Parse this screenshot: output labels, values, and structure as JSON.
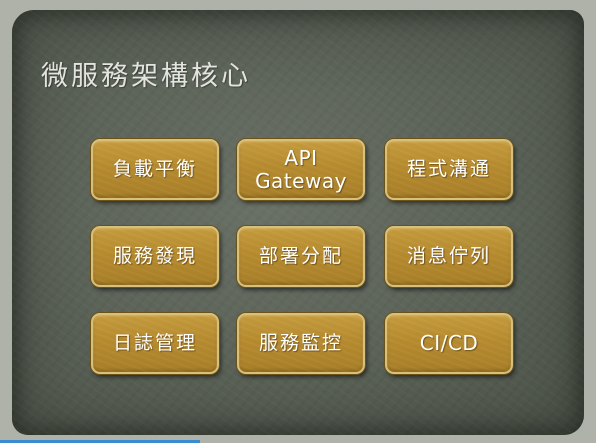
{
  "slide": {
    "title": "微服務架構核心",
    "tiles": [
      {
        "label": "負載平衡"
      },
      {
        "label": "API\nGateway"
      },
      {
        "label": "程式溝通"
      },
      {
        "label": "服務發現"
      },
      {
        "label": "部署分配"
      },
      {
        "label": "消息佇列"
      },
      {
        "label": "日誌管理"
      },
      {
        "label": "服務監控"
      },
      {
        "label": "CI/CD"
      }
    ]
  },
  "colors": {
    "background_panel": "#5d6459",
    "tile_gold": "#b58a2f",
    "tile_border": "#d9c07a",
    "title_text": "#e3e4de",
    "tile_text": "#ffffff"
  }
}
